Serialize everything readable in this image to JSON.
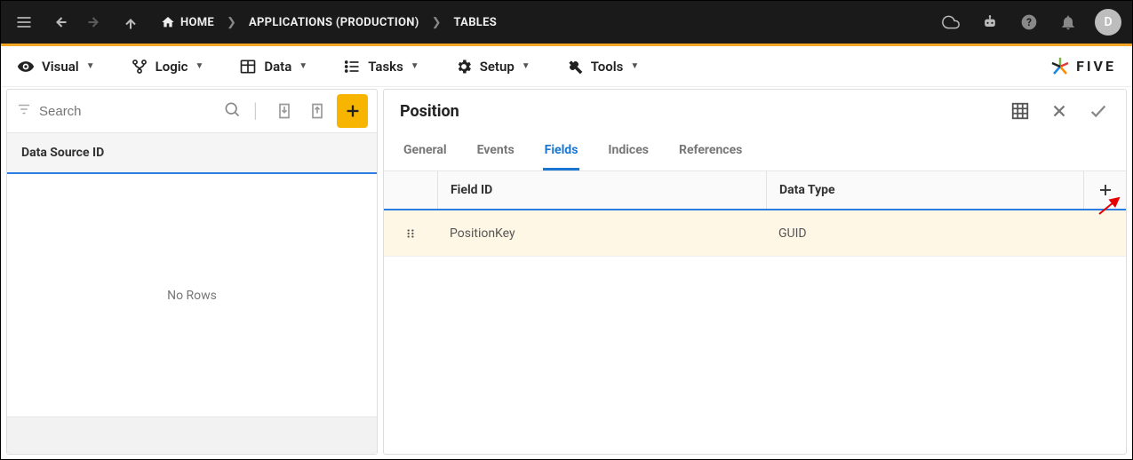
{
  "topbar": {
    "breadcrumbs": [
      {
        "label": "HOME",
        "has_icon": true
      },
      {
        "label": "APPLICATIONS (PRODUCTION)"
      },
      {
        "label": "TABLES"
      }
    ],
    "avatar_initial": "D"
  },
  "menubar": {
    "items": [
      {
        "label": "Visual"
      },
      {
        "label": "Logic"
      },
      {
        "label": "Data"
      },
      {
        "label": "Tasks"
      },
      {
        "label": "Setup"
      },
      {
        "label": "Tools"
      }
    ],
    "logo_text": "FIVE"
  },
  "left_panel": {
    "search_placeholder": "Search",
    "column_header": "Data Source ID",
    "empty_text": "No Rows"
  },
  "right_panel": {
    "title": "Position",
    "tabs": [
      {
        "label": "General",
        "active": false
      },
      {
        "label": "Events",
        "active": false
      },
      {
        "label": "Fields",
        "active": true
      },
      {
        "label": "Indices",
        "active": false
      },
      {
        "label": "References",
        "active": false
      }
    ],
    "columns": {
      "field_id": "Field ID",
      "data_type": "Data Type"
    },
    "rows": [
      {
        "field_id": "PositionKey",
        "data_type": "GUID"
      }
    ]
  }
}
